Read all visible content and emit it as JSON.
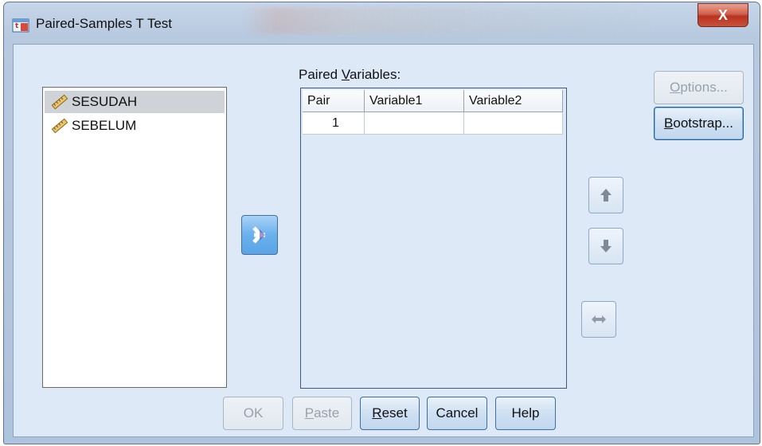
{
  "window": {
    "title": "Paired-Samples T Test",
    "close_glyph": "X"
  },
  "source_list": {
    "items": [
      {
        "label": "SESUDAH",
        "selected": true,
        "icon": "ruler-scale-icon"
      },
      {
        "label": "SEBELUM",
        "selected": false,
        "icon": "ruler-scale-icon"
      }
    ]
  },
  "paired": {
    "label_pre": "Paired ",
    "label_mn": "V",
    "label_post": "ariables:",
    "columns": [
      "Pair",
      "Variable1",
      "Variable2"
    ],
    "rows": [
      {
        "pair": "1",
        "variable1": "",
        "variable2": ""
      }
    ]
  },
  "side_buttons": {
    "options_mn": "O",
    "options_rest": "ptions...",
    "bootstrap_mn": "B",
    "bootstrap_rest": "ootstrap..."
  },
  "bottom_buttons": {
    "ok": "OK",
    "paste_mn": "P",
    "paste_rest": "aste",
    "reset_mn": "R",
    "reset_rest": "eset",
    "cancel": "Cancel",
    "help": "Help"
  },
  "colors": {
    "accent": "#6ab0ec",
    "close": "#c9523c",
    "background": "#dde9f6"
  }
}
